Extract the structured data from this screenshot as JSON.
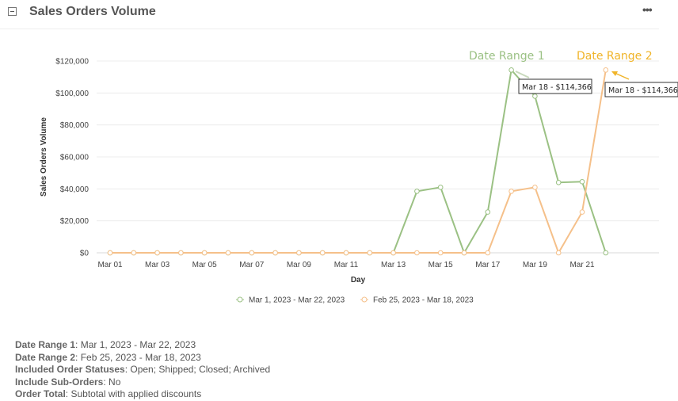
{
  "header": {
    "title": "Sales Orders Volume",
    "more_label": "•••"
  },
  "chart_data": {
    "type": "line",
    "ylabel": "Sales Orders Volume",
    "xlabel": "Day",
    "ylim": [
      0,
      120000
    ],
    "yticks": [
      "$0",
      "$20,000",
      "$40,000",
      "$60,000",
      "$80,000",
      "$100,000",
      "$120,000"
    ],
    "xtick_labels": [
      "Mar 01",
      "Mar 03",
      "Mar 05",
      "Mar 07",
      "Mar 09",
      "Mar 11",
      "Mar 13",
      "Mar 15",
      "Mar 17",
      "Mar 19",
      "Mar 21"
    ],
    "categories": [
      "Mar 01",
      "Mar 02",
      "Mar 03",
      "Mar 04",
      "Mar 05",
      "Mar 06",
      "Mar 07",
      "Mar 08",
      "Mar 09",
      "Mar 10",
      "Mar 11",
      "Mar 12",
      "Mar 13",
      "Mar 14",
      "Mar 15",
      "Mar 16",
      "Mar 17",
      "Mar 18",
      "Mar 19",
      "Mar 20",
      "Mar 21",
      "Mar 22"
    ],
    "series": [
      {
        "name": "Mar 1, 2023 - Mar 22, 2023",
        "color": "#9bc184",
        "values": [
          0,
          0,
          0,
          0,
          0,
          0,
          0,
          0,
          0,
          0,
          0,
          0,
          0,
          38500,
          41000,
          0,
          25500,
          114366,
          98000,
          44000,
          44500,
          0
        ]
      },
      {
        "name": "Feb 25, 2023 - Mar 18, 2023",
        "color": "#f5c08a",
        "values": [
          0,
          0,
          0,
          0,
          0,
          0,
          0,
          0,
          0,
          0,
          0,
          0,
          0,
          0,
          0,
          0,
          0,
          38500,
          41000,
          0,
          25500,
          114366
        ]
      }
    ],
    "annotations": [
      {
        "label": "Date Range 1",
        "color": "#9bc184",
        "tooltip": "Mar 18 - $114,366"
      },
      {
        "label": "Date Range 2",
        "color": "#f0b429",
        "tooltip": "Mar 18 - $114,366"
      }
    ],
    "grid": true,
    "legend_position": "bottom"
  },
  "info": {
    "rows": [
      {
        "label": "Date Range 1",
        "value": ": Mar 1, 2023 - Mar 22, 2023"
      },
      {
        "label": "Date Range 2",
        "value": ": Feb 25, 2023 - Mar 18, 2023"
      },
      {
        "label": "Included Order Statuses",
        "value": ": Open; Shipped; Closed; Archived"
      },
      {
        "label": "Include Sub-Orders",
        "value": ": No"
      },
      {
        "label": "Order Total",
        "value": ": Subtotal with applied discounts"
      }
    ]
  }
}
